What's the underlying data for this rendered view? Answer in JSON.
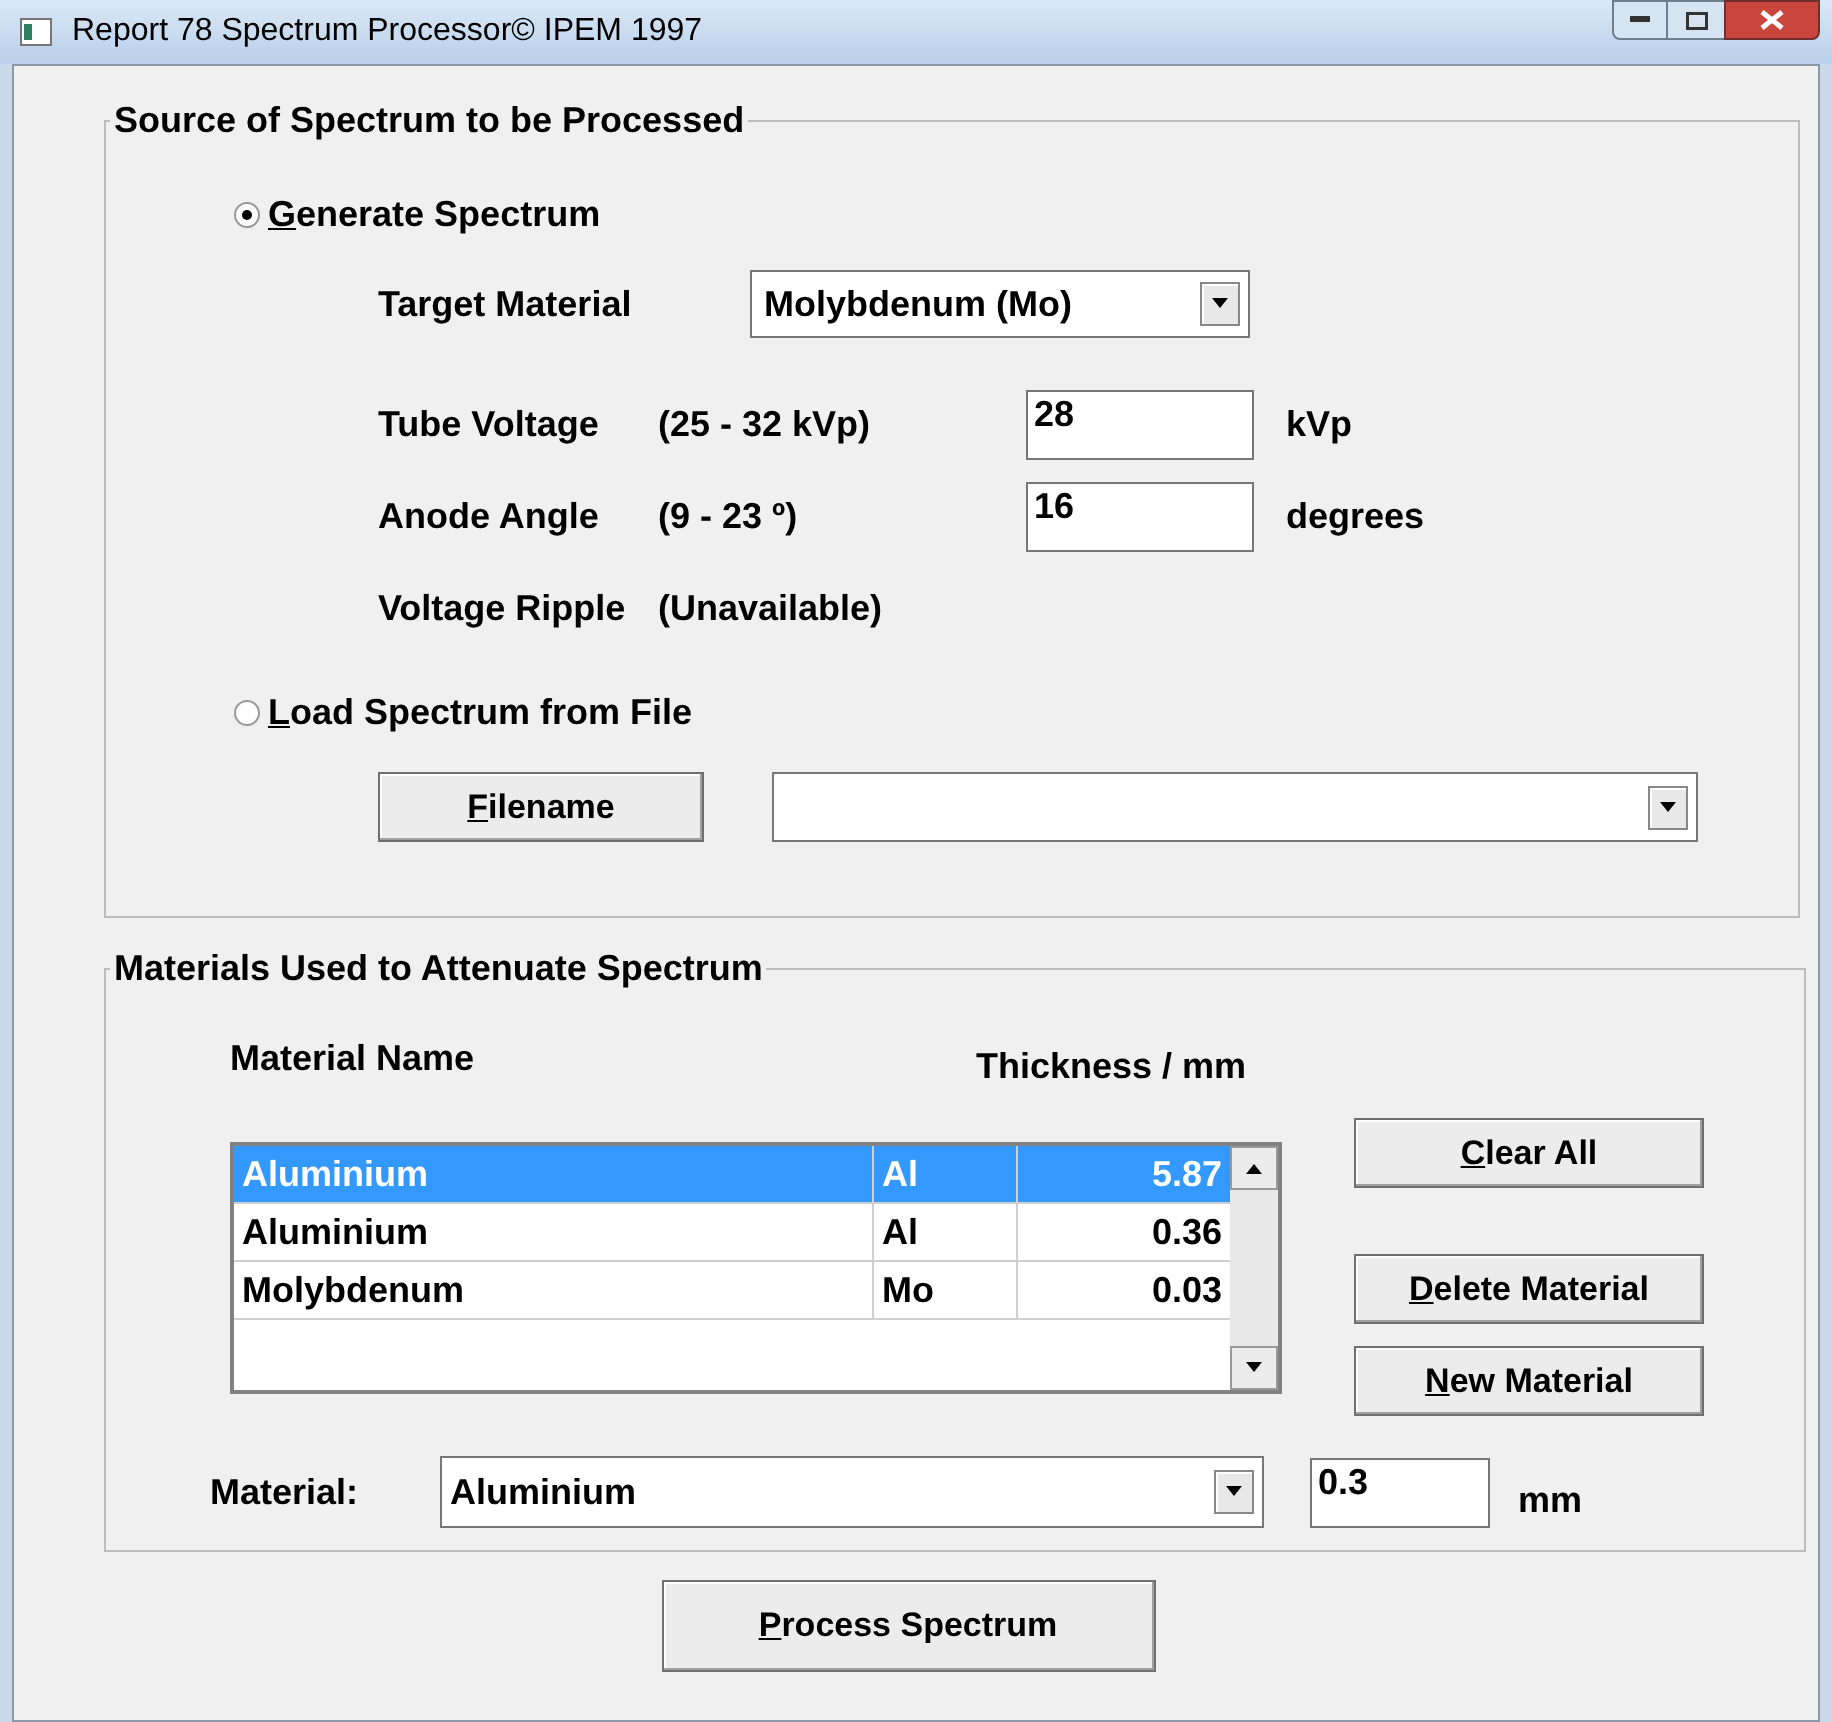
{
  "window": {
    "title": "Report 78 Spectrum Processor© IPEM 1997"
  },
  "source": {
    "legend": "Source of Spectrum to be Processed",
    "options": [
      {
        "label": "Generate Spectrum",
        "selected": true,
        "mnemonic": true
      },
      {
        "label": "Load Spectrum from File",
        "selected": false,
        "mnemonic": true
      }
    ],
    "target_material": {
      "label": "Target Material",
      "value": "Molybdenum (Mo)"
    },
    "parameters": [
      {
        "label": "Tube Voltage",
        "range": "(25 - 32 kVp)",
        "value": "28",
        "unit": "kVp"
      },
      {
        "label": "Anode Angle",
        "range": "(9 - 23 º)",
        "value": "16",
        "unit": "degrees"
      },
      {
        "label": "Voltage Ripple",
        "range": "(Unavailable)"
      }
    ],
    "filename_button": {
      "label": "Filename",
      "mnemonic": true
    }
  },
  "materials": {
    "legend": "Materials Used to Attenuate Spectrum",
    "columns": [
      "Material Name",
      "Thickness / mm"
    ],
    "rows": [
      {
        "name": "Aluminium",
        "symbol": "Al",
        "thickness": "5.87",
        "selected": true
      },
      {
        "name": "Aluminium",
        "symbol": "Al",
        "thickness": "0.36",
        "selected": false
      },
      {
        "name": "Molybdenum",
        "symbol": "Mo",
        "thickness": "0.03",
        "selected": false
      }
    ],
    "buttons": [
      {
        "label": "Clear All",
        "mnemonic": true
      },
      {
        "label": "Delete Material",
        "mnemonic": true
      },
      {
        "label": "New Material",
        "mnemonic": true
      }
    ],
    "material_label": "Material:",
    "material_value": "Aluminium",
    "thickness_value": "0.3",
    "thickness_unit": "mm"
  },
  "process_button": {
    "label": "Process Spectrum",
    "mnemonic": true
  }
}
